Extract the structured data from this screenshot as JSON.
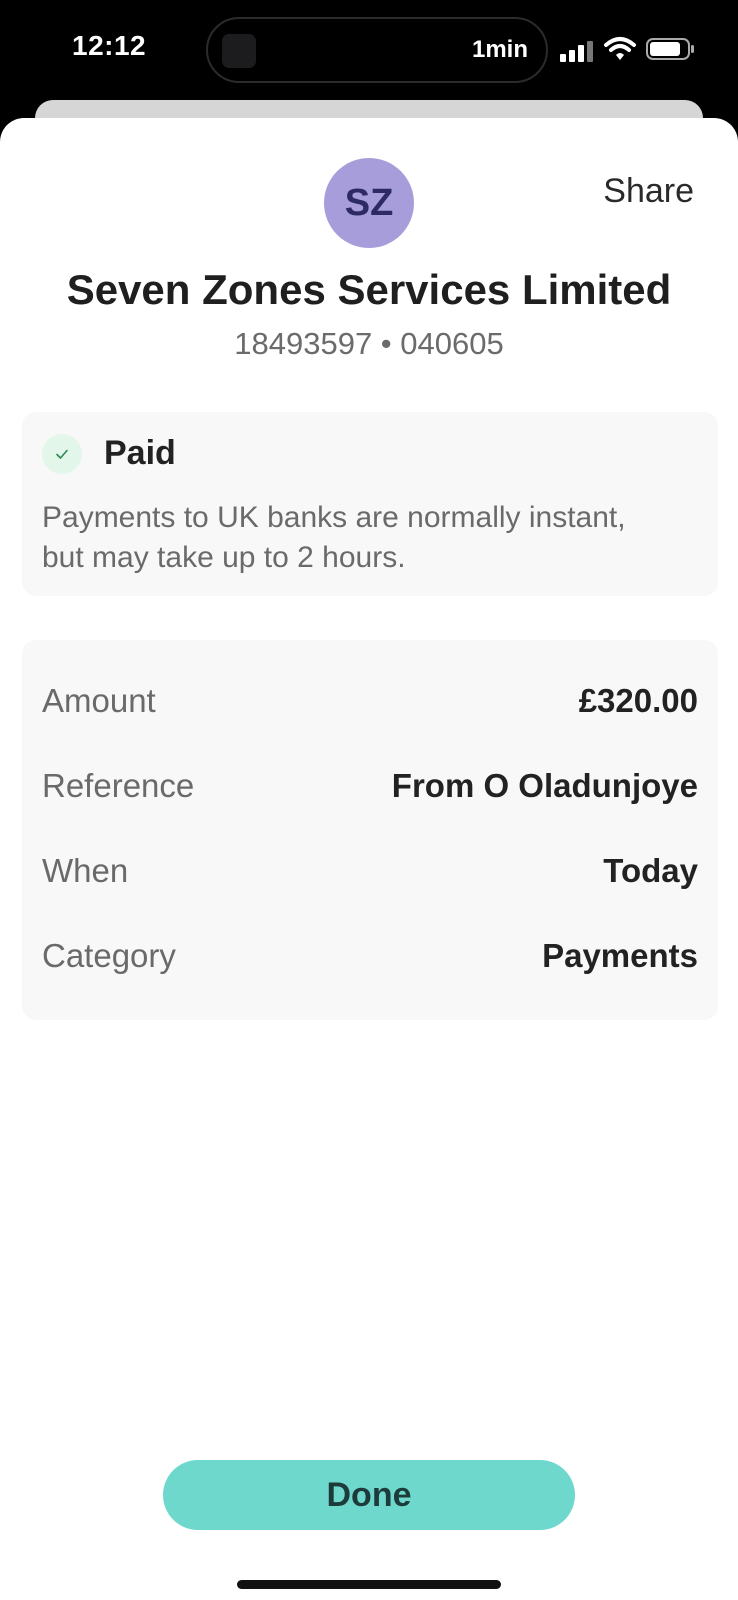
{
  "status_bar": {
    "time": "12:12",
    "island_label": "1min",
    "icons": [
      "signal-icon",
      "wifi-icon",
      "battery-icon"
    ]
  },
  "payee": {
    "initials": "SZ",
    "name": "Seven Zones Services Limited",
    "account": "18493597 • 040605",
    "avatar_color": "#a79ddb"
  },
  "header": {
    "share_label": "Share"
  },
  "status": {
    "label": "Paid",
    "note": "Payments to UK banks are normally instant, but may take up to 2 hours.",
    "icon": "check-icon"
  },
  "details": [
    {
      "label": "Amount",
      "value": "£320.00"
    },
    {
      "label": "Reference",
      "value": "From O Oladunjoye"
    },
    {
      "label": "When",
      "value": "Today"
    },
    {
      "label": "Category",
      "value": "Payments"
    }
  ],
  "footer": {
    "done_label": "Done",
    "button_color": "#6fd8cc"
  }
}
